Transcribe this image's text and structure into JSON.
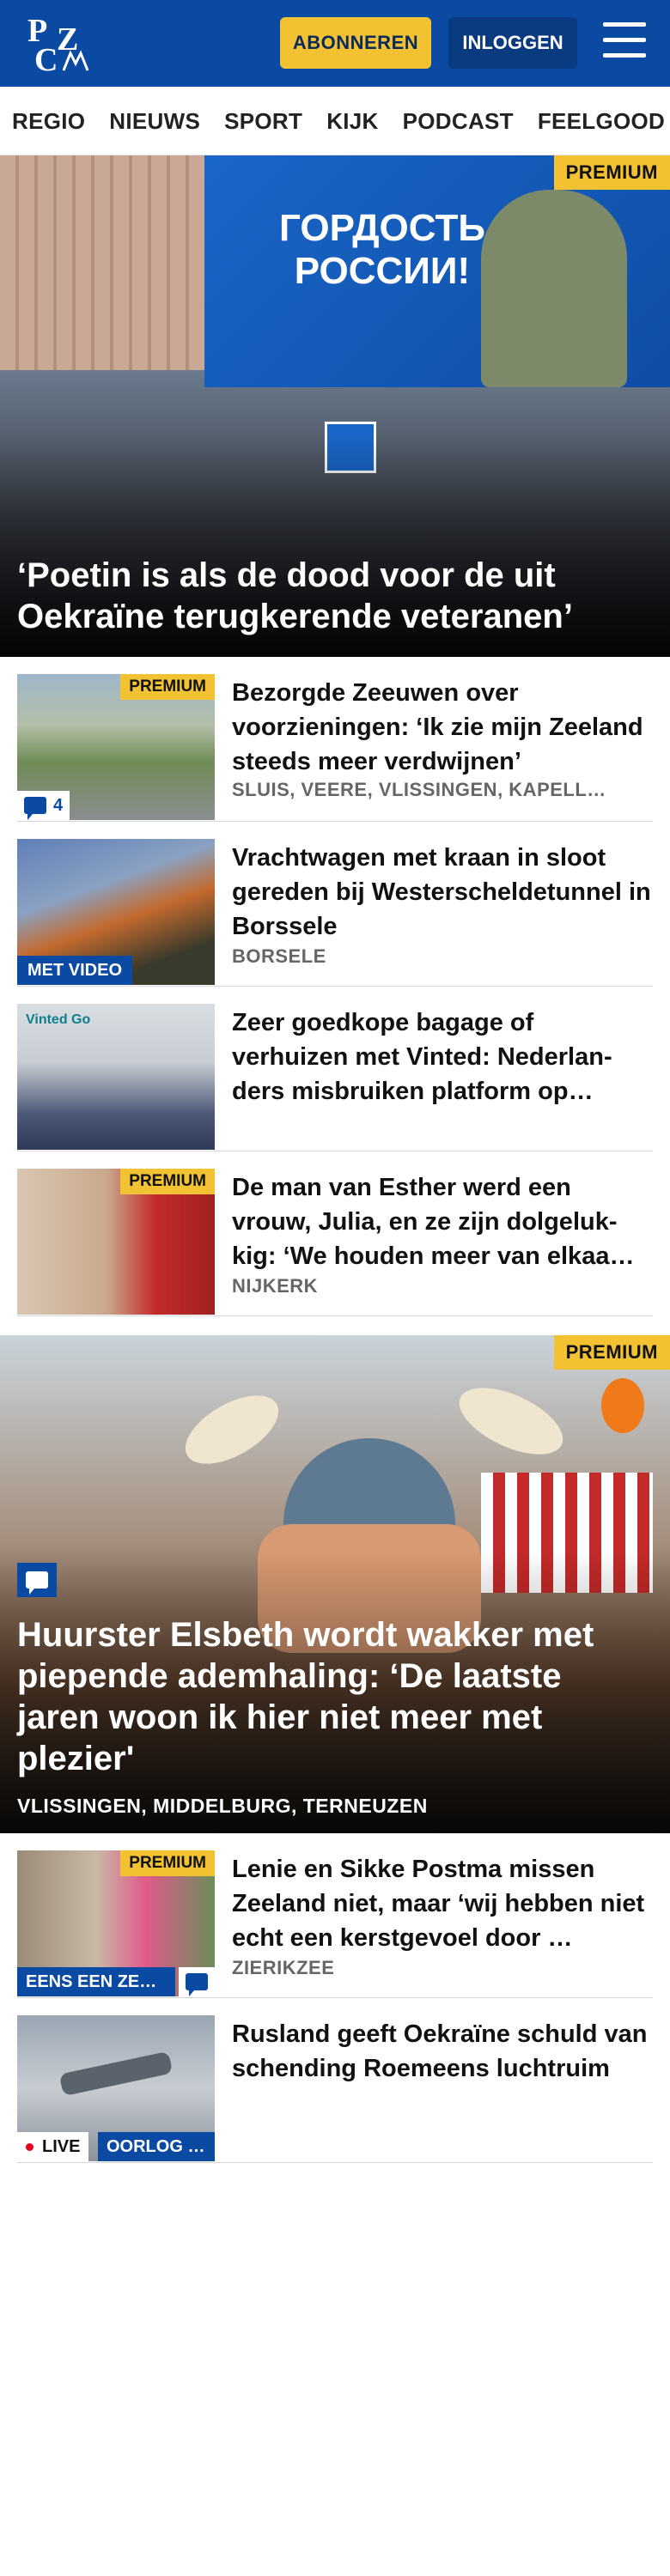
{
  "header": {
    "logo_letters": [
      "P",
      "Z",
      "C"
    ],
    "subscribe_label": "ABONNEREN",
    "login_label": "INLOGGEN",
    "menu_icon": "hamburger-icon",
    "brand_color": "#0a4aa3",
    "accent_color": "#f2c232"
  },
  "nav": {
    "items": [
      "REGIO",
      "NIEUWS",
      "SPORT",
      "KIJK",
      "PODCAST",
      "FEELGOOD"
    ]
  },
  "hero": {
    "badge": "PREMIUM",
    "billboard_text": "ГОРДОСТЬ РОССИИ!",
    "title": "‘Poetin is als de dood voor de uit Oekraïne terugkerende veteranen’"
  },
  "articles": [
    {
      "badge": "PREMIUM",
      "comments": "4",
      "title": "Bezorgde Zeeuwen over voorzieningen: ‘Ik zie mijn Zeeland steeds meer verdwijnen’",
      "meta": "SLUIS, VEERE, VLISSINGEN, KAPELL…"
    },
    {
      "tag": "MET VIDEO",
      "title": "Vrachtwagen met kraan in sloot gereden bij Westerscheldetunnel in Borssele",
      "meta": "BORSELE"
    },
    {
      "thumb_text": "Vinted Go",
      "title": "Zeer goedkope bagage of verhuizen met Vinted: Nederlan-ders misbruiken platform op…",
      "meta": ""
    },
    {
      "badge": "PREMIUM",
      "title": "De man van Esther werd een vrouw, Julia, en ze zijn dolgeluk-kig: ‘We houden meer van elkaa…",
      "meta": "NIJKERK"
    }
  ],
  "feature": {
    "badge": "PREMIUM",
    "title": "Huurster Elsbeth wordt wakker met piepende ademhaling: ‘De laatste jaren woon ik hier niet meer met plezier'",
    "meta": "VLISSINGEN, MIDDELBURG, TERNEUZEN"
  },
  "articles2": [
    {
      "badge": "PREMIUM",
      "tag": "EENS EEN ZE…",
      "title": "Lenie en Sikke Postma missen Zeeland niet, maar ‘wij hebben niet echt een kerstgevoel door …",
      "meta": "ZIERIKZEE"
    },
    {
      "live": "LIVE",
      "tag": "OORLOG …",
      "title": "Rusland geeft Oekraïne schuld van schending Roemeens luchtruim",
      "meta": ""
    }
  ]
}
